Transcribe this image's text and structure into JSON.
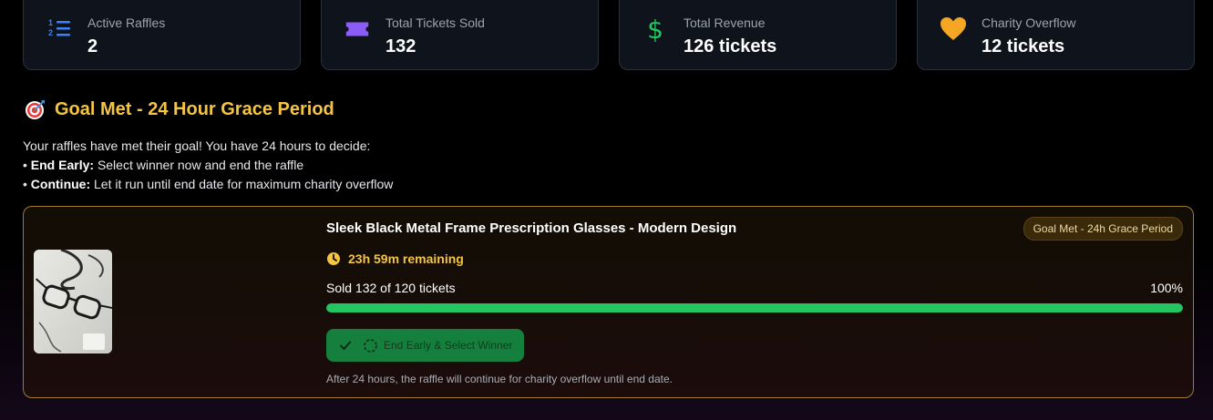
{
  "stats": [
    {
      "label": "Active Raffles",
      "value": "2",
      "icon": "numbered-list-icon",
      "color": "#3b82f6"
    },
    {
      "label": "Total Tickets Sold",
      "value": "132",
      "icon": "ticket-icon",
      "color": "#8b5cf6"
    },
    {
      "label": "Total Revenue",
      "value": "126 tickets",
      "icon": "dollar-icon",
      "color": "#22c55e"
    },
    {
      "label": "Charity Overflow",
      "value": "12 tickets",
      "icon": "heart-icon",
      "color": "#f5a623"
    }
  ],
  "section": {
    "title": "Goal Met - 24 Hour Grace Period",
    "icon": "target-icon",
    "intro": "Your raffles have met their goal! You have 24 hours to decide:",
    "options": [
      {
        "label": "End Early:",
        "text": "Select winner now and end the raffle"
      },
      {
        "label": "Continue:",
        "text": "Let it run until end date for maximum charity overflow"
      }
    ]
  },
  "raffle": {
    "title": "Sleek Black Metal Frame Prescription Glasses - Modern Design",
    "badge": "Goal Met - 24h Grace Period",
    "time_remaining": "23h 59m remaining",
    "sold_text": "Sold 132 of 120 tickets",
    "percent_text": "100%",
    "progress": 100,
    "button_label": "End Early & Select Winner",
    "note": "After 24 hours, the raffle will continue for charity overflow until end date."
  },
  "colors": {
    "accent_yellow": "#f5c542",
    "progress_green": "#22c55e",
    "card_border": "#a17a2c"
  }
}
